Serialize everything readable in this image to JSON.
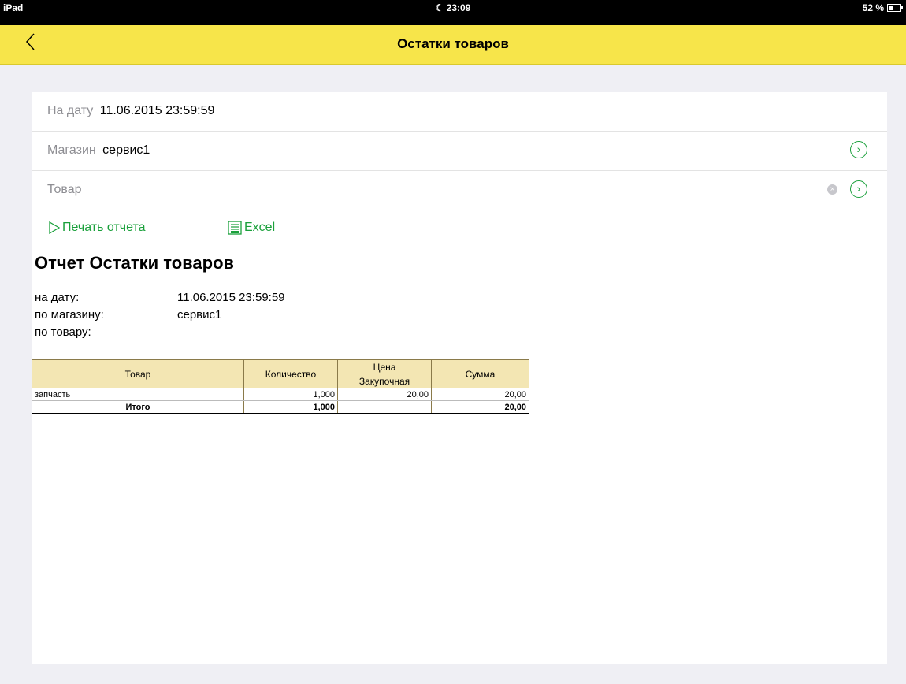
{
  "status": {
    "carrier": "iPad",
    "time": "23:09",
    "battery": "52 %",
    "battery_level": 0.52
  },
  "nav": {
    "title": "Остатки товаров"
  },
  "form": {
    "date_label": "На дату",
    "date_value": "11.06.2015 23:59:59",
    "store_label": "Магазин",
    "store_value": "сервис1",
    "product_label": "Товар",
    "product_value": ""
  },
  "actions": {
    "print_label": "Печать отчета",
    "excel_label": "Excel"
  },
  "report": {
    "title": "Отчет Остатки товаров",
    "meta": [
      {
        "label": "на дату:",
        "value": "11.06.2015 23:59:59"
      },
      {
        "label": "по магазину:",
        "value": "сервис1"
      },
      {
        "label": "по товару:",
        "value": ""
      }
    ],
    "table": {
      "headers": {
        "product": "Товар",
        "qty": "Количество",
        "price": "Цена",
        "price_sub": "Закупочная",
        "sum": "Сумма"
      },
      "rows": [
        {
          "product": "запчасть",
          "qty": "1,000",
          "price": "20,00",
          "sum": "20,00"
        }
      ],
      "total": {
        "label": "Итого",
        "qty": "1,000",
        "price": "",
        "sum": "20,00"
      }
    }
  },
  "colors": {
    "nav": "#f7e54a",
    "accent": "#1aa03b",
    "table_header": "#f3e6b3"
  }
}
